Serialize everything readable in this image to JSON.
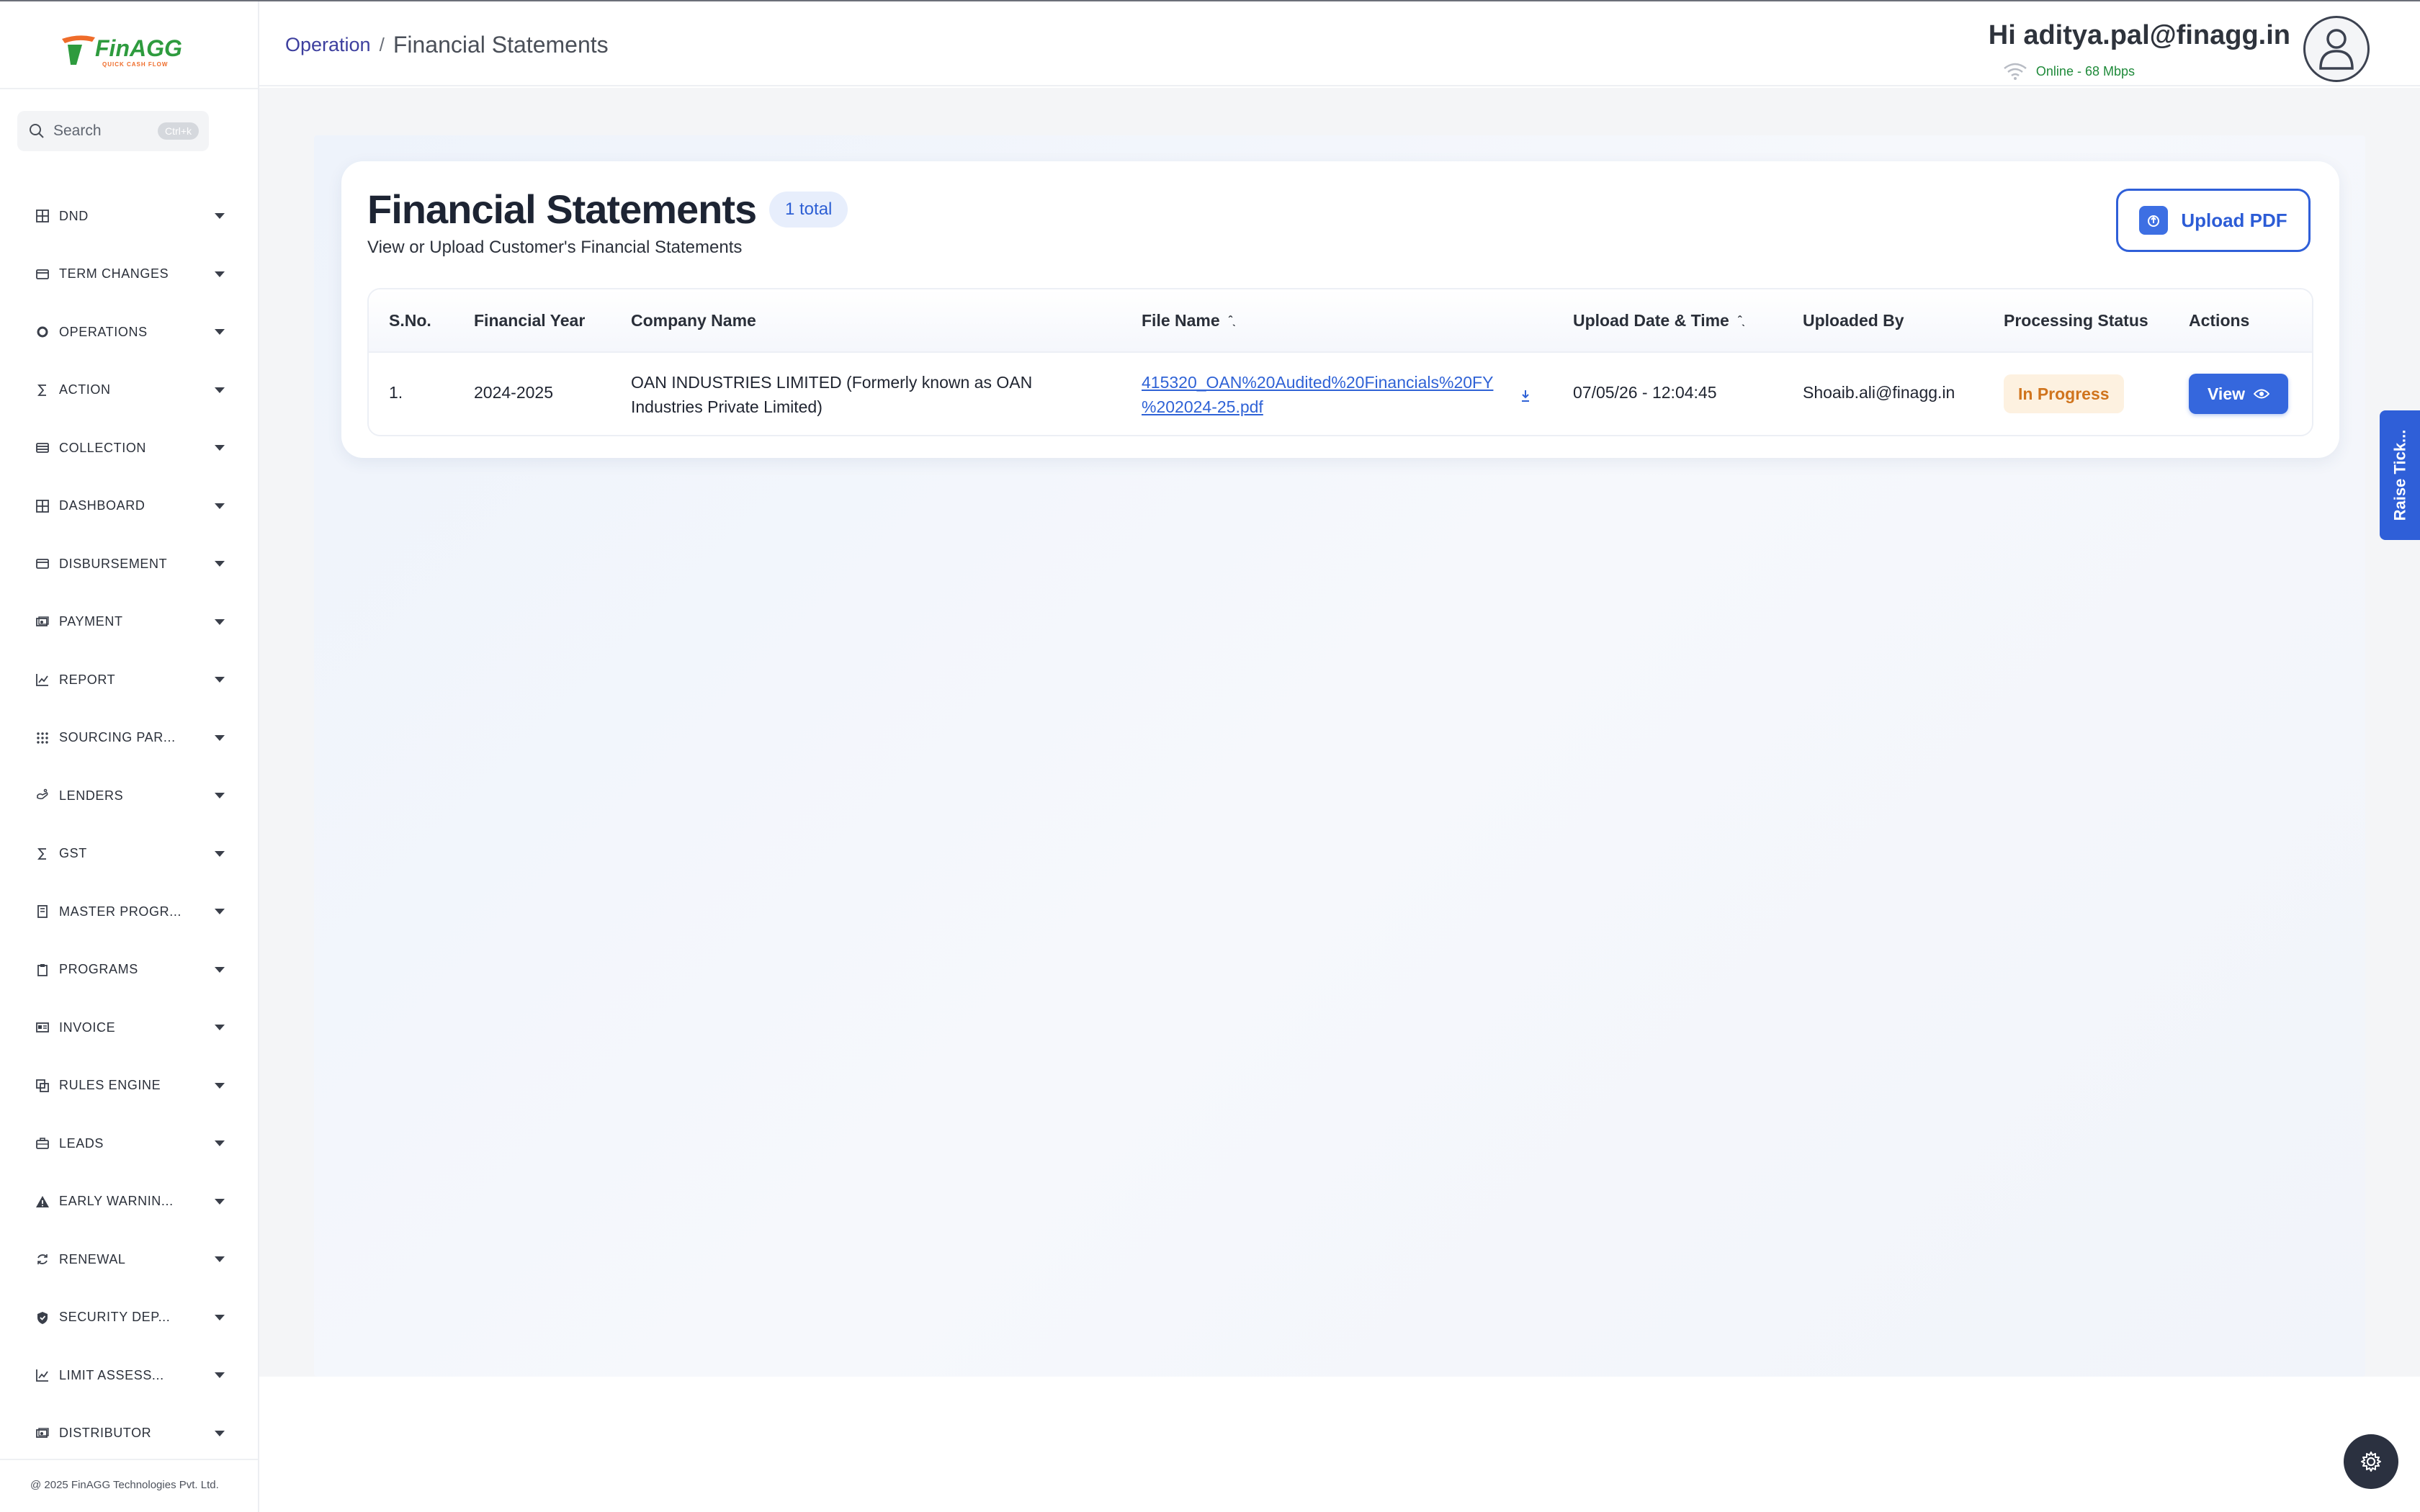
{
  "app": {
    "logo_text": "FinAGG",
    "logo_tagline": "QUICK CASH FLOW",
    "copyright": "@ 2025 FinAGG Technologies Pvt. Ltd."
  },
  "search": {
    "placeholder": "Search",
    "shortcut": "Ctrl+k"
  },
  "sidebar": {
    "items": [
      {
        "label": "DND",
        "icon": "grid-icon"
      },
      {
        "label": "TERM CHANGES",
        "icon": "card-icon"
      },
      {
        "label": "OPERATIONS",
        "icon": "gear-icon"
      },
      {
        "label": "ACTION",
        "icon": "sigma-icon"
      },
      {
        "label": "COLLECTION",
        "icon": "stack-icon"
      },
      {
        "label": "DASHBOARD",
        "icon": "grid-icon"
      },
      {
        "label": "DISBURSEMENT",
        "icon": "card-icon"
      },
      {
        "label": "PAYMENT",
        "icon": "money-icon"
      },
      {
        "label": "REPORT",
        "icon": "chart-icon"
      },
      {
        "label": "SOURCING PAR...",
        "icon": "dots-grid-icon"
      },
      {
        "label": "LENDERS",
        "icon": "hand-icon"
      },
      {
        "label": "GST",
        "icon": "sigma-icon"
      },
      {
        "label": "MASTER PROGR...",
        "icon": "book-icon"
      },
      {
        "label": "PROGRAMS",
        "icon": "clipboard-icon"
      },
      {
        "label": "INVOICE",
        "icon": "id-card-icon"
      },
      {
        "label": "RULES ENGINE",
        "icon": "copy-icon"
      },
      {
        "label": "LEADS",
        "icon": "briefcase-icon"
      },
      {
        "label": "EARLY WARNIN...",
        "icon": "warning-icon"
      },
      {
        "label": "RENEWAL",
        "icon": "refresh-icon"
      },
      {
        "label": "SECURITY DEP...",
        "icon": "shield-icon"
      },
      {
        "label": "LIMIT ASSESS...",
        "icon": "chart-icon"
      },
      {
        "label": "DISTRIBUTOR",
        "icon": "money-icon"
      }
    ]
  },
  "header": {
    "breadcrumb_parent": "Operation",
    "breadcrumb_sep": "/",
    "breadcrumb_current": "Financial Statements",
    "greeting": "Hi aditya.pal@finagg.in",
    "connection_status": "Online - 68 Mbps"
  },
  "page": {
    "title": "Financial Statements",
    "total_badge": "1 total",
    "subtitle": "View or Upload Customer's Financial Statements",
    "upload_button": "Upload PDF"
  },
  "table": {
    "columns": [
      "S.No.",
      "Financial Year",
      "Company Name",
      "File Name",
      "Upload Date & Time",
      "Uploaded By",
      "Processing Status",
      "Actions"
    ],
    "sort_glyph": "ˆˎ",
    "rows": [
      {
        "sno": "1.",
        "financial_year": "2024-2025",
        "company_line1": "OAN INDUSTRIES LIMITED (Formerly known as OAN",
        "company_line2": "Industries Private Limited)",
        "file_line1": "415320_OAN%20Audited%20Financials%20FY",
        "file_line2": "%202024-25.pdf",
        "upload_datetime": "07/05/26 - 12:04:45",
        "uploaded_by": "Shoaib.ali@finagg.in",
        "status": "In Progress",
        "action_label": "View"
      }
    ]
  },
  "floating": {
    "raise_ticket": "Raise Tick..."
  },
  "colors": {
    "brand_blue": "#2f5fd8",
    "link_blue": "#2f62d6",
    "status_orange": "#d0741d",
    "status_bg": "#fdf1e0",
    "online_green": "#1f8a3a",
    "logo_green": "#2e9b3e",
    "logo_orange": "#ef6c2a"
  }
}
